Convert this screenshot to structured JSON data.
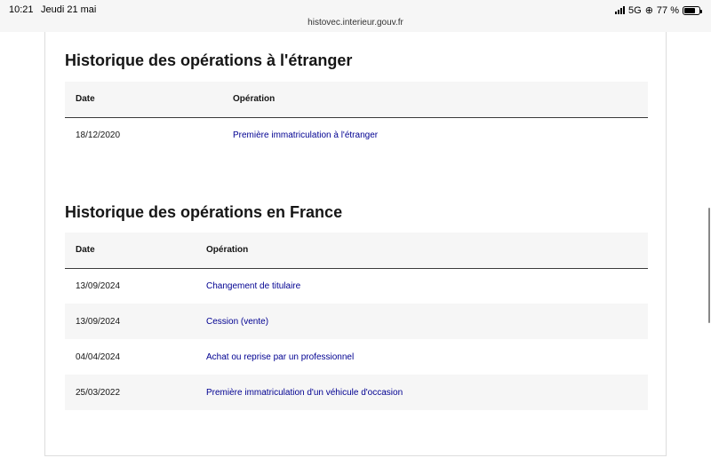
{
  "status_bar": {
    "time": "10:21",
    "date": "Jeudi 21 mai",
    "network": "5G",
    "battery": "77 %",
    "battery_level": 0.77
  },
  "url": "histovec.interieur.gouv.fr",
  "foreign": {
    "title": "Historique des opérations à l'étranger",
    "headers": [
      "Date",
      "Opération"
    ],
    "rows": [
      {
        "date": "18/12/2020",
        "operation": "Première immatriculation à l'étranger"
      }
    ]
  },
  "france": {
    "title": "Historique des opérations en France",
    "headers": [
      "Date",
      "Opération"
    ],
    "rows": [
      {
        "date": "13/09/2024",
        "operation": "Changement de titulaire"
      },
      {
        "date": "13/09/2024",
        "operation": "Cession (vente)"
      },
      {
        "date": "04/04/2024",
        "operation": "Achat ou reprise par un professionnel"
      },
      {
        "date": "25/03/2022",
        "operation": "Première immatriculation d'un véhicule d'occasion"
      }
    ]
  }
}
